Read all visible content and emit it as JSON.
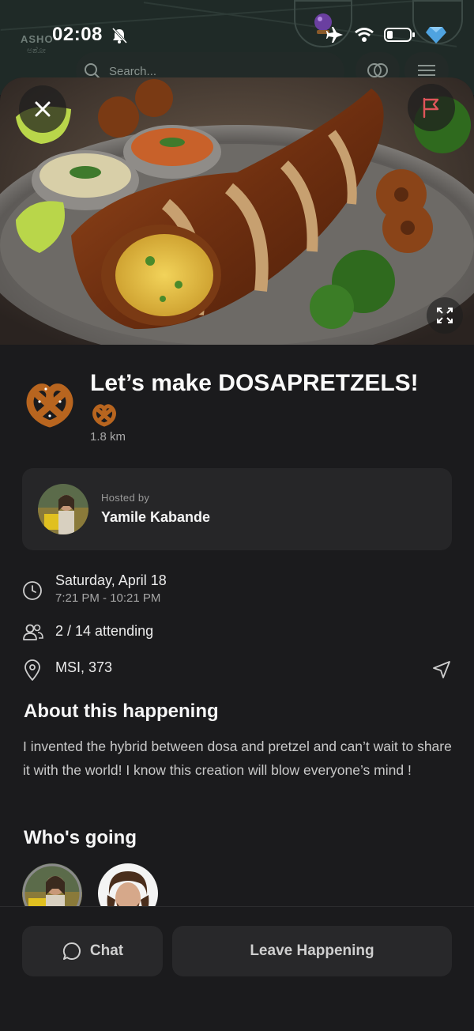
{
  "status_bar": {
    "time": "02:08"
  },
  "background_app": {
    "map_label": "ASHO",
    "map_label_local": "ಅಶೋ",
    "search_placeholder": "Search..."
  },
  "event": {
    "title": "Let’s make DOSAPRETZELS!",
    "emoji": "🥨",
    "distance": "1.8 km"
  },
  "host": {
    "label": "Hosted by",
    "name": "Yamile Kabande"
  },
  "details": {
    "date": "Saturday, April 18",
    "time_range": "7:21 PM - 10:21 PM",
    "attending": "2 / 14 attending",
    "location": "MSI, 373"
  },
  "about": {
    "heading": "About this happening",
    "body": "I invented the hybrid between dosa and pretzel and can’t wait to share it with the world! I know this creation will blow everyone’s mind !"
  },
  "attendees": {
    "heading": "Who's going"
  },
  "actions": {
    "chat_label": "Chat",
    "leave_label": "Leave Happening"
  },
  "colors": {
    "background": "#1b1b1d",
    "card": "#262628",
    "flag_accent": "#e0555a"
  }
}
